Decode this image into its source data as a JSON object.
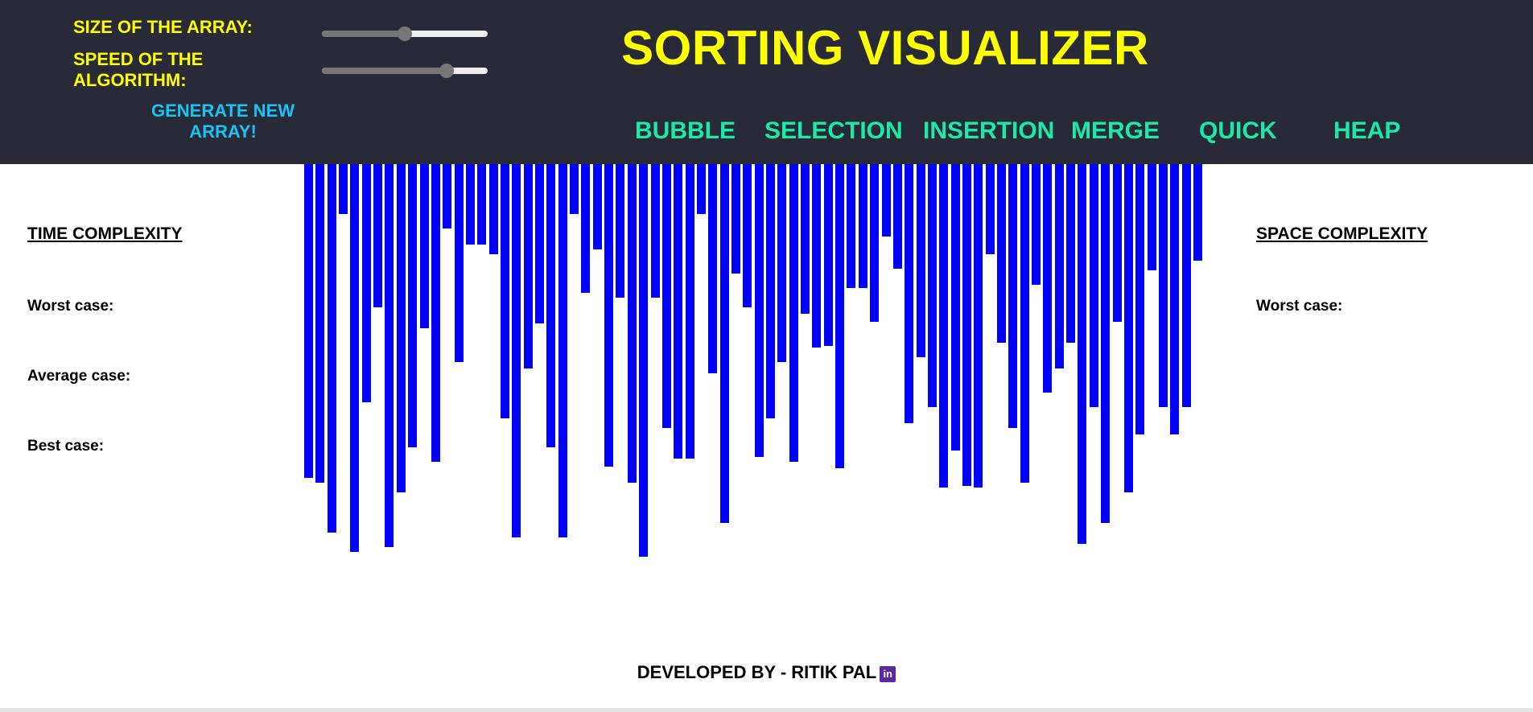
{
  "header": {
    "title": "SORTING VISUALIZER",
    "size_label": "SIZE OF THE ARRAY:",
    "speed_label": "SPEED OF THE ALGORITHM:",
    "generate_label": "GENERATE NEW ARRAY!",
    "size_value_fraction": 0.5,
    "speed_value_fraction": 0.75
  },
  "algorithms": [
    {
      "label": "BUBBLE"
    },
    {
      "label": "SELECTION"
    },
    {
      "label": "INSERTION"
    },
    {
      "label": "MERGE"
    },
    {
      "label": "QUICK"
    },
    {
      "label": "HEAP"
    }
  ],
  "time_complexity": {
    "title": "TIME COMPLEXITY",
    "worst_label": "Worst case:",
    "average_label": "Average case:",
    "best_label": "Best case:"
  },
  "space_complexity": {
    "title": "SPACE COMPLEXITY",
    "worst_label": "Worst case:"
  },
  "array_values": [
    390,
    396,
    458,
    62,
    482,
    296,
    178,
    476,
    408,
    352,
    204,
    370,
    80,
    246,
    100,
    100,
    112,
    316,
    464,
    254,
    198,
    352,
    464,
    62,
    160,
    106,
    376,
    166,
    396,
    488,
    166,
    328,
    366,
    366,
    62,
    260,
    446,
    136,
    178,
    364,
    316,
    246,
    370,
    186,
    228,
    226,
    378,
    154,
    154,
    196,
    90,
    130,
    322,
    240,
    302,
    402,
    356,
    400,
    402,
    112,
    222,
    328,
    396,
    150,
    284,
    254,
    222,
    472,
    302,
    446,
    196,
    408,
    336,
    132,
    302,
    336,
    302,
    120
  ],
  "colors": {
    "header_bg": "#282b37",
    "title": "#ffff00",
    "algo_button": "#1de9a6",
    "generate_button": "#18c4f5",
    "bar": "#0000ff"
  },
  "footer": {
    "text": "DEVELOPED BY - RITIK PAL",
    "icon": "linkedin-icon"
  }
}
